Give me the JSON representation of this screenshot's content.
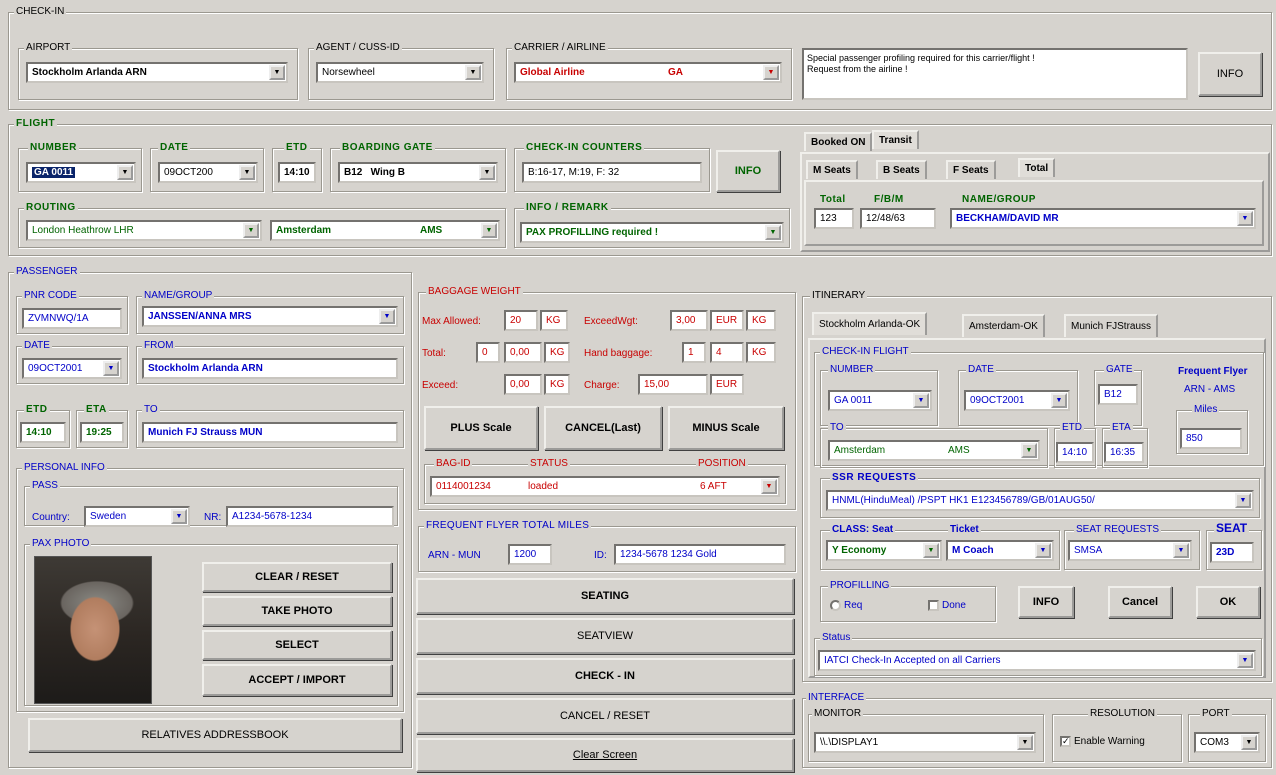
{
  "checkin": {
    "legend": "CHECK-IN",
    "airport": {
      "legend": "AIRPORT",
      "value": "Stockholm Arlanda  ARN"
    },
    "agent": {
      "legend": "AGENT / CUSS-ID",
      "value": "Norsewheel"
    },
    "carrier": {
      "legend": "CARRIER / AIRLINE",
      "name": "Global Airline",
      "code": "GA"
    },
    "message": [
      "Special passenger profiling required for this carrier/flight !",
      "Request from the airline !"
    ],
    "info_button": "INFO"
  },
  "flight": {
    "legend": "FLIGHT",
    "number": {
      "legend": "NUMBER",
      "value": "GA 0011"
    },
    "date": {
      "legend": "DATE",
      "value": "09OCT200"
    },
    "etd": {
      "legend": "ETD",
      "value": "14:10"
    },
    "gate": {
      "legend": "BOARDING GATE",
      "value": "B12   Wing B"
    },
    "counters": {
      "legend": "CHECK-IN COUNTERS",
      "value": "B:16-17, M:19, F: 32"
    },
    "info_button": "INFO",
    "routing": {
      "legend": "ROUTING",
      "from": "London Heathrow  LHR",
      "to": "Amsterdam",
      "to_code": "AMS"
    },
    "remark": {
      "legend": "INFO / REMARK",
      "value": "PAX PROFILLING required !"
    },
    "booked_tabs": [
      "Booked ON",
      "Transit"
    ],
    "seat_tabs": [
      "M Seats",
      "B Seats",
      "F Seats",
      "Total"
    ],
    "total": {
      "legend": "Total",
      "value": "123"
    },
    "fbm": {
      "legend": "F/B/M",
      "value": "12/48/63"
    },
    "name_group": {
      "legend": "NAME/GROUP",
      "value": "BECKHAM/DAVID MR"
    }
  },
  "passenger": {
    "legend": "PASSENGER",
    "pnr": {
      "legend": "PNR CODE",
      "value": "ZVMNWQ/1A"
    },
    "name": {
      "legend": "NAME/GROUP",
      "value": "JANSSEN/ANNA MRS"
    },
    "date": {
      "legend": "DATE",
      "value": "09OCT2001"
    },
    "from": {
      "legend": "FROM",
      "value": "Stockholm Arlanda  ARN"
    },
    "etd": {
      "legend": "ETD",
      "value": "14:10"
    },
    "eta": {
      "legend": "ETA",
      "value": "19:25"
    },
    "to": {
      "legend": "TO",
      "value": "Munich FJ Strauss  MUN"
    },
    "personal": {
      "legend": "PERSONAL INFO",
      "pass_legend": "PASS",
      "country_label": "Country:",
      "country": "Sweden",
      "nr_label": "NR:",
      "nr": "A1234-5678-1234"
    },
    "photo": {
      "legend": "PAX PHOTO",
      "buttons": [
        "CLEAR / RESET",
        "TAKE PHOTO",
        "SELECT",
        "ACCEPT / IMPORT"
      ]
    },
    "relatives": "RELATIVES ADDRESSBOOK"
  },
  "baggage": {
    "legend": "BAGGAGE WEIGHT",
    "max_label": "Max Allowed:",
    "max": "20",
    "kg": "KG",
    "total_label": "Total:",
    "total_count": "0",
    "total": "0,00",
    "exceed_label": "Exceed:",
    "exceed": "0,00",
    "exceed_wgt_label": "ExceedWgt:",
    "exceed_wgt": "3,00",
    "eur": "EUR",
    "hand_label": "Hand baggage:",
    "hand_count": "1",
    "hand_weight": "4",
    "charge_label": "Charge:",
    "charge": "15,00",
    "buttons": [
      "PLUS Scale",
      "CANCEL(Last)",
      "MINUS Scale"
    ],
    "bag_id_label": "BAG-ID",
    "status_label": "STATUS",
    "position_label": "POSITION",
    "bag_id": "0114001234",
    "status": "loaded",
    "position": "6 AFT"
  },
  "ffm": {
    "legend": "FREQUENT FLYER TOTAL MILES",
    "route": "ARN - MUN",
    "miles": "1200",
    "id_label": "ID:",
    "id": "1234-5678 1234  Gold"
  },
  "actions": [
    "SEATING",
    "SEATVIEW",
    "CHECK - IN",
    "CANCEL / RESET",
    "Clear Screen"
  ],
  "itinerary": {
    "legend": "ITINERARY",
    "tabs": [
      "Stockholm Arlanda-OK",
      "Amsterdam-OK",
      "Munich FJStrauss"
    ],
    "checkin_flight_legend": "CHECK-IN FLIGHT",
    "number": {
      "legend": "NUMBER",
      "value": "GA 0011"
    },
    "date": {
      "legend": "DATE",
      "value": "09OCT2001"
    },
    "gate": {
      "legend": "GATE",
      "value": "B12"
    },
    "ff_label": "Frequent Flyer",
    "ff_route": "ARN - AMS",
    "miles": {
      "legend": "Miles",
      "value": "850"
    },
    "to": {
      "legend": "TO",
      "value": "Amsterdam",
      "code": "AMS"
    },
    "etd": {
      "legend": "ETD",
      "value": "14:10"
    },
    "eta": {
      "legend": "ETA",
      "value": "16:35"
    },
    "ssr": {
      "legend": "SSR REQUESTS",
      "value": "HNML(HinduMeal)  /PSPT HK1 E123456789/GB/01AUG50/"
    },
    "class_label": "CLASS: Seat",
    "ticket_label": "Ticket",
    "class": "Y Economy",
    "ticket": "M Coach",
    "seat_req": {
      "legend": "SEAT REQUESTS",
      "value": "SMSA"
    },
    "seat": {
      "legend": "SEAT",
      "value": "23D"
    },
    "profiling": {
      "legend": "PROFILLING",
      "req": "Req",
      "done": "Done"
    },
    "buttons": [
      "INFO",
      "Cancel",
      "OK"
    ],
    "status": {
      "legend": "Status",
      "value": "IATCI Check-In  Accepted on all Carriers"
    }
  },
  "interface": {
    "legend": "INTERFACE",
    "monitor": {
      "legend": "MONITOR",
      "value": "\\\\.\\DISPLAY1"
    },
    "resolution": {
      "legend": "RESOLUTION",
      "check": "Enable Warning"
    },
    "port": {
      "legend": "PORT",
      "value": "COM3"
    }
  }
}
